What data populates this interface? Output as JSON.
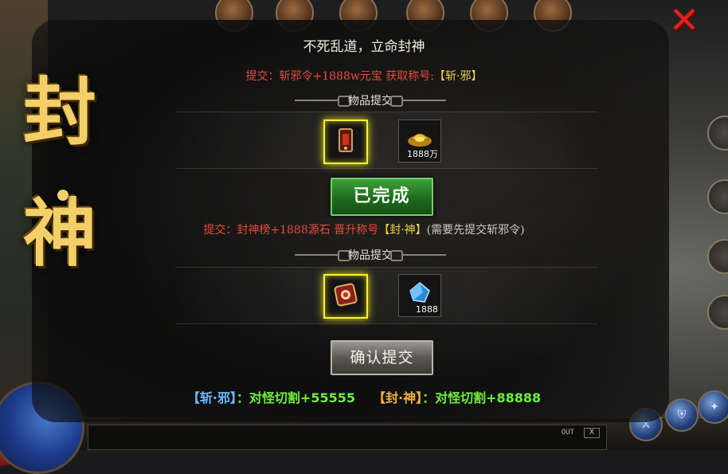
{
  "window": {
    "close_glyph": "✕"
  },
  "banner": {
    "line1": "封",
    "line2": "神"
  },
  "heading": "不死乱道，立命封神",
  "quest1": {
    "requirement": "提交：斩邪令+1888w元宝 获取称号:",
    "title_tag": "【斩·邪】",
    "section_label": "物品提交",
    "items": [
      {
        "icon": "demon-token-icon",
        "count": ""
      },
      {
        "icon": "gold-ingot-icon",
        "count": "1888万"
      }
    ],
    "status_label": "已完成"
  },
  "quest2": {
    "requirement": "提交：封神榜+1888源石 晋升称号",
    "title_tag": "【封·神】",
    "note": "(需要先提交斩邪令)",
    "section_label": "物品提交",
    "items": [
      {
        "icon": "deity-scroll-icon",
        "count": ""
      },
      {
        "icon": "blue-crystal-icon",
        "count": "1888"
      }
    ],
    "confirm_label": "确认提交"
  },
  "bonuses": {
    "tag1": "【斩·邪】",
    "text1": "：对怪切割+55555",
    "tag2": "【封·神】",
    "text2": "：对怪切割+88888"
  },
  "chat": {
    "out_label": "OUT",
    "close_label": "X"
  },
  "colors": {
    "title_gold": "#f3cf6a",
    "requirement_red": "#e84a3a",
    "tag_yellow": "#f0d24a",
    "done_green": "#2e8a2a",
    "bonus_green": "#6ef03c",
    "bonus_blue": "#6fb8ff",
    "bonus_orange": "#f2b23a"
  }
}
